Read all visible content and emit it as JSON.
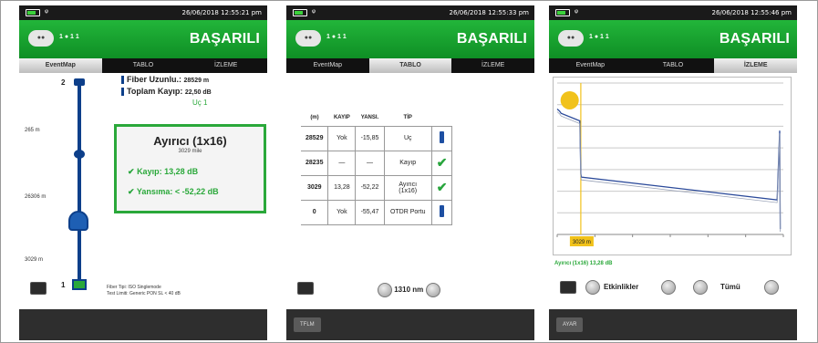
{
  "screens": [
    {
      "status_datetime": "26/06/2018 12:55:21 pm",
      "result": "BAŞARILI",
      "device_dots": "1 ● 1 1",
      "tabs": [
        "EventMap",
        "TABLO",
        "İZLEME"
      ],
      "active_tab": 0,
      "map": {
        "top_event_num": "2",
        "bottom_event_num": "1",
        "distances": [
          "265 m",
          "26306 m",
          "3029 m"
        ],
        "fiber_length_label": "Fiber Uzunlu.:",
        "fiber_length_value": "28529 m",
        "total_loss_label": "Toplam Kayıp:",
        "total_loss_value": "22,50 dB",
        "warn_note": "Uç 1",
        "popup_title": "Ayırıcı (1x16)",
        "popup_sub": "3029 mile",
        "popup_loss": "Kayıp: 13,28 dB",
        "popup_refl": "Yansıma: < -52,22 dB",
        "footer1": "Fiber Tipi: ISO Singlemode",
        "footer2": "Test Limiti: Generic PON SL < 40 dB"
      },
      "softkey": ""
    },
    {
      "status_datetime": "26/06/2018 12:55:33 pm",
      "result": "BAŞARILI",
      "device_dots": "1 ● 1 1",
      "tabs": [
        "EventMap",
        "TABLO",
        "İZLEME"
      ],
      "active_tab": 1,
      "table": {
        "headers": [
          "(m)",
          "KAYIP",
          "YANSI.",
          "TİP"
        ],
        "rows": [
          {
            "m": "28529",
            "loss": "Yok",
            "refl": "-15,85",
            "type": "Uç",
            "icon": "info-icon"
          },
          {
            "m": "28235",
            "loss": "—",
            "refl": "—",
            "type": "Kayıp",
            "icon": "check-icon"
          },
          {
            "m": "3029",
            "loss": "13,28",
            "refl": "-52,22",
            "type": "Ayırıcı (1x16)",
            "icon": "check-icon"
          },
          {
            "m": "0",
            "loss": "Yok",
            "refl": "-55,47",
            "type": "OTDR Portu",
            "icon": "info-icon"
          }
        ]
      },
      "wavelength": "1310 nm",
      "softkey": "TFLM"
    },
    {
      "status_datetime": "26/06/2018 12:55:46 pm",
      "result": "BAŞARILI",
      "device_dots": "1 ● 1 1",
      "tabs": [
        "EventMap",
        "TABLO",
        "İZLEME"
      ],
      "active_tab": 2,
      "chart_data": {
        "type": "line",
        "cursor_label": "3029 m",
        "x": [
          0,
          300,
          500,
          2900,
          3029,
          3100,
          28200,
          28529,
          28600
        ],
        "values": [
          11.6,
          11.4,
          11.2,
          10.5,
          5.6,
          5.3,
          3.2,
          9.6,
          0.5
        ],
        "xlim": [
          0,
          29000
        ],
        "ylim": [
          0,
          14
        ],
        "grid": true
      },
      "event_label": "Ayırıcı (1x16) 13,28 dB",
      "events_label": "Etkinlikler",
      "zoom_label": "Tümü",
      "softkey": "AYAR"
    }
  ],
  "colors": {
    "green": "#1aa534",
    "navy": "#0d3f8a",
    "accent": "#f1c21b"
  }
}
